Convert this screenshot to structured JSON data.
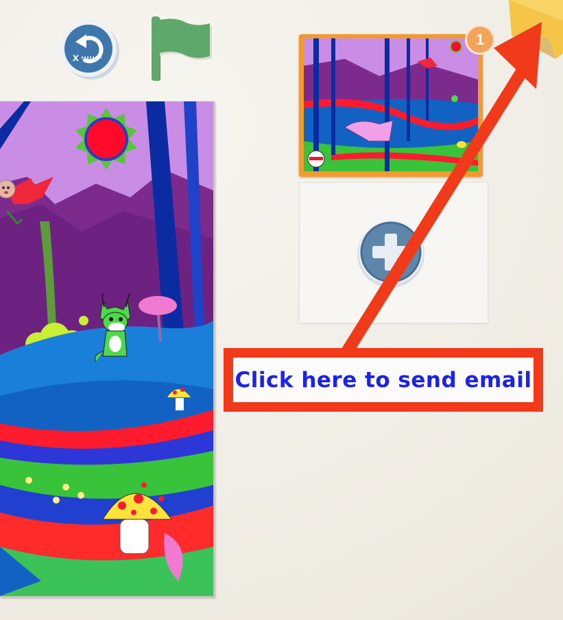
{
  "toolbar": {
    "undo_icon": "undo-icon",
    "flag_icon": "green-flag-icon"
  },
  "pages": {
    "thumbnail_badge": "1",
    "add_icon": "plus-icon"
  },
  "callout": {
    "text": "Click here to send email"
  },
  "colors": {
    "callout_border": "#f03a1a",
    "callout_text": "#1d22e8",
    "thumbnail_frame": "#f39a2d",
    "flag_green": "#5fa86b",
    "undo_blue": "#3f77ad"
  }
}
